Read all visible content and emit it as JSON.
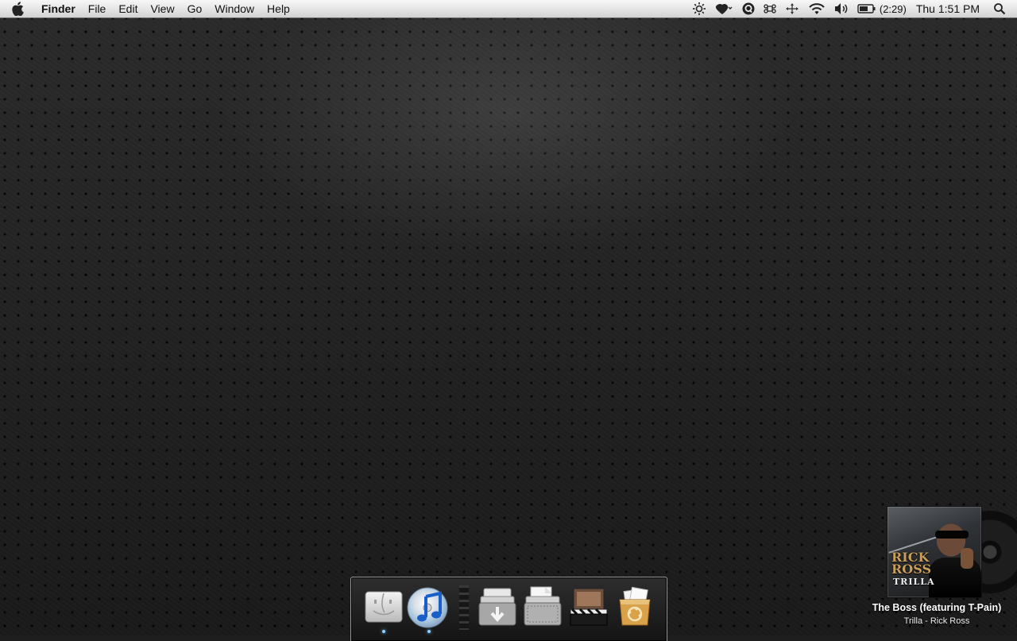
{
  "menubar": {
    "items": [
      "Finder",
      "File",
      "Edit",
      "View",
      "Go",
      "Window",
      "Help"
    ],
    "battery_time": "(2:29)",
    "clock": "Thu 1:51 PM",
    "status_icons": [
      "brightness-icon",
      "growl-icon",
      "quicksilver-icon",
      "command-icon",
      "network-activity-icon",
      "wifi-icon",
      "volume-icon",
      "battery-icon",
      "spotlight-icon"
    ]
  },
  "now_playing": {
    "title": "The Boss (featuring T-Pain)",
    "subtitle": "Trilla - Rick Ross",
    "cover_artist_text": "RICK ROSS",
    "cover_album_text": "TRILLA"
  },
  "dock": {
    "items": [
      "finder-icon",
      "itunes-icon",
      "downloads-stack-icon",
      "documents-stack-icon",
      "movies-stack-icon",
      "trash-icon"
    ],
    "running_indicator_color": "#8fd0ff"
  },
  "colors": {
    "menubar_bg": "#e6e6e6",
    "desktop_bg": "#1e1e1e"
  }
}
